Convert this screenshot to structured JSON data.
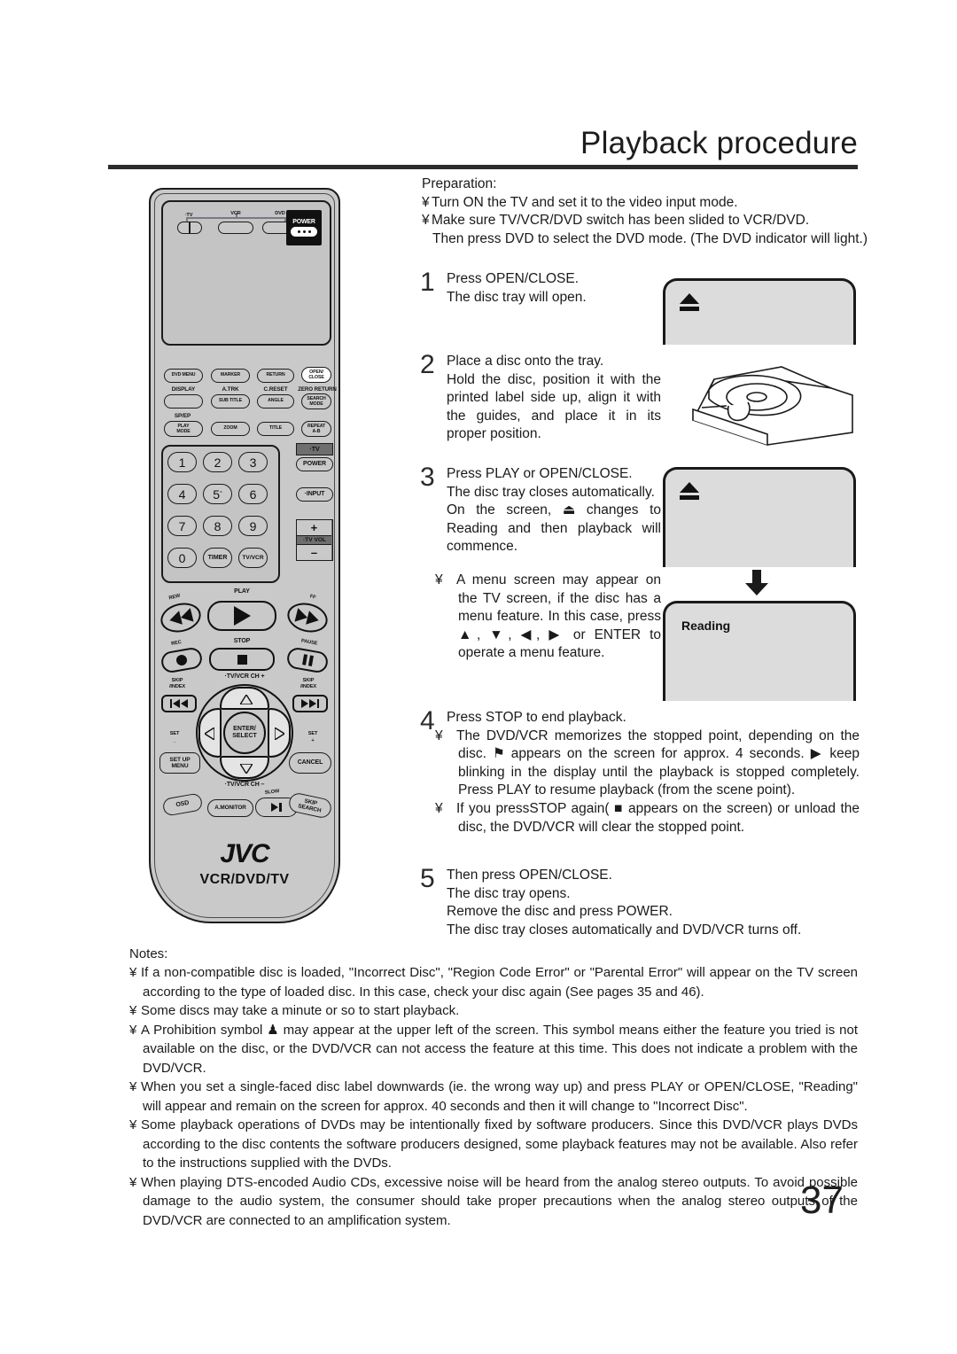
{
  "header": {
    "title": "Playback procedure"
  },
  "preparation": {
    "heading": "Preparation:",
    "lines": [
      "Turn ON the TV and set it to the video input mode.",
      "Make sure TV/VCR/DVD switch has been slided to VCR/DVD.",
      "Then press DVD to select the DVD mode. (The DVD indicator will light.)"
    ]
  },
  "steps": [
    {
      "number": "1",
      "lines": [
        "Press OPEN/CLOSE.",
        "The disc tray will open."
      ]
    },
    {
      "number": "2",
      "lines": [
        "Place a disc onto the tray.",
        "Hold the disc, position it with the printed label side up, align it with the guides, and place it in its proper position."
      ]
    },
    {
      "number": "3",
      "lines": [
        "Press PLAY or OPEN/CLOSE.",
        "The disc tray closes automatically.",
        "On the screen, ⏏ changes to  Reading  and then playback will commence."
      ],
      "bullet": "A menu screen may appear on the TV screen, if the disc has a menu feature. In this case, press ▲, ▼, ◀, ▶ or ENTER to operate a menu feature."
    },
    {
      "number": "4",
      "lines": [
        "Press STOP to end playback."
      ],
      "bullets": [
        "The DVD/VCR memorizes the stopped point, depending on the disc.  ⚑  appears on the screen for approx. 4 seconds.  ▶  keep blinking in the display until the playback is stopped completely. Press PLAY to resume playback (from the scene point).",
        "If you pressSTOP again( ■  appears on the screen) or unload the disc, the DVD/VCR will clear the stopped point."
      ]
    },
    {
      "number": "5",
      "lines": [
        "Then press OPEN/CLOSE.",
        "The disc tray opens.",
        "Remove the disc and press POWER.",
        "The disc tray closes automatically and DVD/VCR turns off."
      ]
    }
  ],
  "screens": {
    "screen1_icon": "eject-icon",
    "screen2_icon": "eject-icon",
    "screen3_label": "Reading"
  },
  "notes": {
    "heading": "Notes:",
    "items": [
      "If a non-compatible disc is loaded, \"Incorrect Disc\", \"Region Code Error\" or \"Parental Error\" will appear on the TV screen according to the type of loaded disc. In this case, check your disc again (See pages 35 and 46).",
      "Some discs may take a minute or so to start playback.",
      "A  Prohibition  symbol ♟ may appear at the upper left of the screen. This symbol means either the feature you tried is not available on the disc, or the DVD/VCR can not access the feature at this time. This does not indicate a problem with the DVD/VCR.",
      "When you set a single-faced disc label downwards (ie. the wrong way up) and press PLAY or OPEN/CLOSE, \"Reading\" will appear and remain on the screen for approx. 40 seconds and then it will change to \"Incorrect Disc\".",
      "Some playback operations of DVDs may be intentionally fixed by software producers. Since this DVD/VCR plays DVDs according to the disc contents the software producers designed, some playback features may not be available. Also refer to the instructions supplied with the DVDs.",
      "When playing DTS-encoded Audio CDs, excessive noise will be heard from the analog stereo outputs. To avoid possible damage to the audio system, the consumer should take proper precautions when the analog stereo outputs of the DVD/VCR are connected to an amplification system."
    ]
  },
  "page_number": "37",
  "remote": {
    "brand": "JVC",
    "model": "VCR/DVD/TV",
    "mode_switch": {
      "tv": "·TV",
      "vcr": "VCR",
      "dvd": "DVD"
    },
    "power": "POWER",
    "function_rows": [
      [
        "DVD MENU",
        "MARKER",
        "RETURN",
        "OPEN/\nCLOSE"
      ],
      [
        "SUB TITLE",
        "ANGLE",
        "SEARCH\nMODE"
      ],
      [
        "PLAY\nMODE",
        "ZOOM",
        "TITLE",
        "REPEAT\nA-B"
      ]
    ],
    "function_labels": [
      "DISPLAY",
      "A.TRK",
      "C.RESET",
      "ZERO RETURN",
      "SP/EP"
    ],
    "keypad": [
      "1",
      "2",
      "3",
      "4",
      "5",
      "6",
      "7",
      "8",
      "9",
      "0",
      "TIMER",
      "TV/VCR"
    ],
    "tv_column": {
      "tv": "·TV",
      "power": "POWER",
      "input": "·INPUT",
      "vol_up": "+",
      "vol_label": "·TV VOL",
      "vol_down": "–"
    },
    "transport_labels": {
      "rew": "REW",
      "play": "PLAY",
      "ff": "FF",
      "rec": "REC",
      "stop": "STOP",
      "pause": "PAUSE",
      "skip_index_left": "SKIP\n/INDEX",
      "skip_index_right": "SKIP\n/INDEX",
      "ch_up": "·TV/VCR CH +",
      "ch_down": "·TV/VCR CH –",
      "set_minus": "SET\n–",
      "set_plus": "SET\n+",
      "enter": "ENTER/\nSELECT",
      "setup_menu": "SET UP\nMENU",
      "cancel": "CANCEL",
      "osd": "OSD",
      "a_monitor": "A.MONITOR",
      "slow": "SLOW",
      "skip_search": "SKIP\nSEARCH"
    }
  }
}
